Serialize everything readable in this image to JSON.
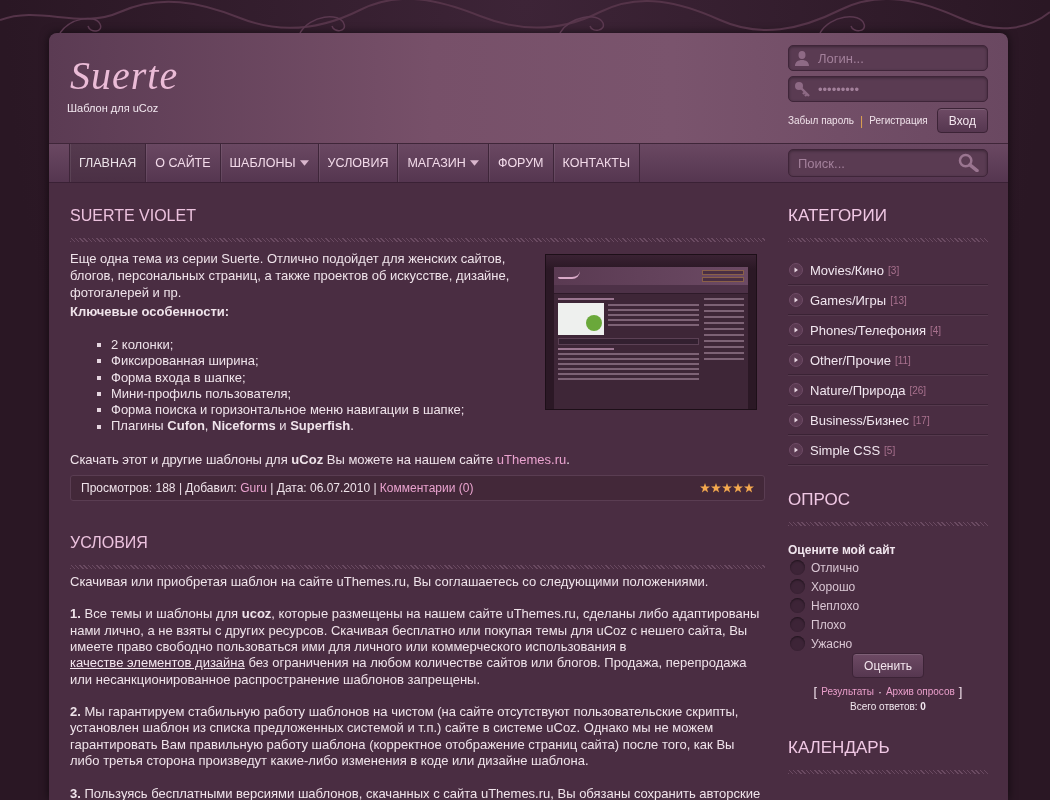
{
  "header": {
    "logo": "Suerte",
    "tagline": "Шаблон для uCoz"
  },
  "login": {
    "username": {
      "placeholder": "Логин..."
    },
    "password": {
      "placeholder": "•••••••••"
    },
    "links": [
      "Забыл пароль",
      "Регистрация"
    ],
    "separator": "|",
    "button": "Вход"
  },
  "nav": [
    {
      "label": "ГЛАВНАЯ",
      "selected": true,
      "dropdown": false
    },
    {
      "label": "О САЙТЕ",
      "selected": false,
      "dropdown": false
    },
    {
      "label": "ШАБЛОНЫ",
      "selected": false,
      "dropdown": true
    },
    {
      "label": "УСЛОВИЯ",
      "selected": false,
      "dropdown": false
    },
    {
      "label": "МАГАЗИН",
      "selected": false,
      "dropdown": true
    },
    {
      "label": "ФОРУМ",
      "selected": false,
      "dropdown": false
    },
    {
      "label": "КОНТАКТЫ",
      "selected": false,
      "dropdown": false
    }
  ],
  "search": {
    "placeholder": "Поиск..."
  },
  "post": {
    "title": "SUERTE VIOLET",
    "intro": "Еще одна тема из серии Suerte. Отлично подойдет для женских сайтов, блогов, персональных страниц, а также проектов об искусстве, дизайне, фотогалерей и пр.",
    "features_heading": "Ключевые особенности:",
    "features": [
      "2 колонки;",
      "Фиксированная ширина;",
      "Форма входа в шапке;",
      "Мини-профиль пользователя;",
      "Форма поиска и горизонтальное меню навигации в шапке;",
      "Плагины **Cufon**, **Niceforms** и **Superfish**."
    ],
    "download": [
      {
        "kind": "text",
        "text": "Скачать этот и другие шаблоны для **uCoz** Вы можете на нашем сайте "
      },
      {
        "kind": "link",
        "text": "uThemes.ru"
      },
      {
        "kind": "text",
        "text": "."
      }
    ],
    "meta": [
      {
        "kind": "text",
        "text": "Просмотров: 188 | Добавил: "
      },
      {
        "kind": "link",
        "text": "Guru"
      },
      {
        "kind": "text",
        "text": " | Дата: 06.07.2010 | "
      },
      {
        "kind": "link",
        "text": "Комментарии (0)"
      }
    ],
    "stars": 5
  },
  "terms": {
    "title": "УСЛОВИЯ",
    "paragraphs": [
      [
        {
          "kind": "text",
          "text": "Скачивая или приобретая шаблон на сайте uThemes.ru, Вы соглашаетесь со следующими положениями."
        }
      ],
      [
        {
          "kind": "text",
          "text": "**1.** Все темы и шаблоны для **ucoz**, которые размещены на нашем сайте uThemes.ru, сделаны либо адаптированы нами лично, а не взяты с других ресурсов. Скачивая бесплатно или покупая темы для uCoz с нешего сайта, Вы имеете право свободно пользоваться ими для личного или коммерческого использования в "
        },
        {
          "kind": "underlined",
          "text": "качестве элементов дизайна"
        },
        {
          "kind": "text",
          "text": " без ограничения на любом количестве сайтов или блогов. Продажа, перепродажа или несанкционированное распространение шаблонов запрещены."
        }
      ],
      [
        {
          "kind": "text",
          "text": "**2.** Мы гарантируем стабильную работу шаблонов на чистом (на сайте отсутствуют пользовательские скрипты, установлен шаблон из списка предложенных системой и т.п.) сайте в системе uCoz. Однако мы не можем гарантировать Вам правильную работу шаблона (корректное отображение страниц сайта) после того, как Вы либо третья сторона произведут какие-либо изменения в коде или дизайне шаблона."
        }
      ],
      [
        {
          "kind": "text",
          "text": "**3.** Пользуясь бесплатными версиями шаблонов, скачанных с сайта uThemes.ru, Вы обязаны сохранить авторские"
        }
      ]
    ]
  },
  "sidebar": {
    "categories": {
      "title": "КАТЕГОРИИ",
      "items": [
        {
          "name": "Movies/Кино",
          "count": "[3]"
        },
        {
          "name": "Games/Игры",
          "count": "[13]"
        },
        {
          "name": "Phones/Телефония",
          "count": "[4]"
        },
        {
          "name": "Other/Прочие",
          "count": "[11]"
        },
        {
          "name": "Nature/Природа",
          "count": "[26]"
        },
        {
          "name": "Business/Бизнес",
          "count": "[17]"
        },
        {
          "name": "Simple CSS",
          "count": "[5]"
        }
      ]
    },
    "poll": {
      "title": "ОПРОС",
      "question": "Оцените мой сайт",
      "options": [
        {
          "label": "Отлично",
          "selected": false
        },
        {
          "label": "Хорошо",
          "selected": false
        },
        {
          "label": "Неплохо",
          "selected": false
        },
        {
          "label": "Плохо",
          "selected": false
        },
        {
          "label": "Ужасно",
          "selected": false
        }
      ],
      "button": "Оценить",
      "open_bracket": "[",
      "links": [
        "Результаты",
        "Архив опросов"
      ],
      "link_separator": "·",
      "close_bracket": "]",
      "total": "Всего ответов: **0**"
    },
    "calendar": {
      "title": "КАЛЕНДАРЬ"
    }
  }
}
